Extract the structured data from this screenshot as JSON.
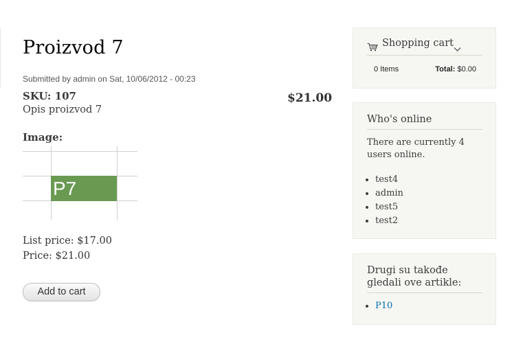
{
  "product": {
    "title": "Proizvod 7",
    "submitted": "Submitted by admin on Sat, 10/06/2012 - 00:23",
    "sku": "SKU: 107",
    "display_price": "$21.00",
    "description": "Opis proizvod 7",
    "image_label": "Image:",
    "image_text": "P7",
    "list_price": "List price: $17.00",
    "price": "Price: $21.00",
    "add_to_cart_label": "Add to cart"
  },
  "shopping_cart": {
    "title": "Shopping cart",
    "items": "0 Items",
    "total_label": "Total:",
    "total_value": "$0.00"
  },
  "whos_online": {
    "title": "Who's online",
    "text": "There are currently 4 users online.",
    "users": [
      "test4",
      "admin",
      "test5",
      "test2"
    ]
  },
  "also_viewed": {
    "title": "Drugi su takođe gledali ove artikle:",
    "links": [
      "P10"
    ]
  },
  "colors": {
    "sidebar_bg": "#f6f6f2",
    "link": "#0071b3",
    "image_tile": "#6a9a52"
  }
}
